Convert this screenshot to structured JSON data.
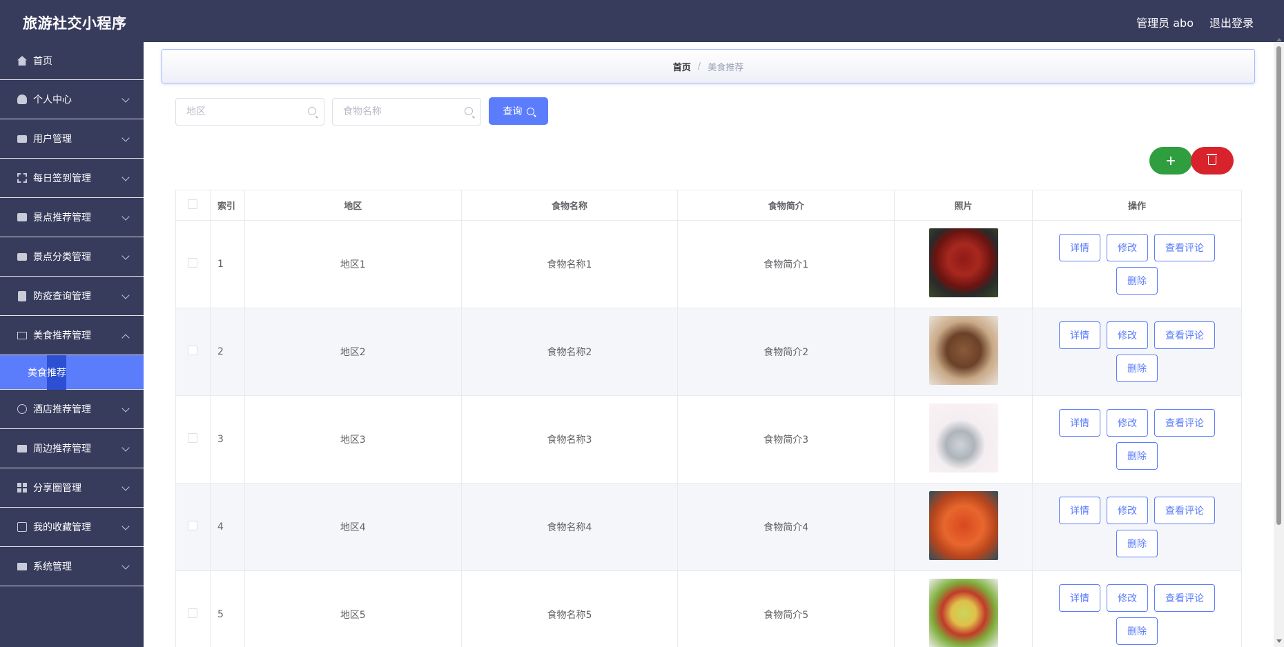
{
  "app": {
    "title": "旅游社交小程序"
  },
  "header": {
    "admin_label": "管理员 abo",
    "logout_label": "退出登录"
  },
  "sidebar": {
    "items": [
      {
        "label": "首页",
        "icon": "home-icon"
      },
      {
        "label": "个人中心",
        "icon": "user-icon"
      },
      {
        "label": "用户管理",
        "icon": "chat-icon"
      },
      {
        "label": "每日签到管理",
        "icon": "frame-icon"
      },
      {
        "label": "景点推荐管理",
        "icon": "briefcase-icon"
      },
      {
        "label": "景点分类管理",
        "icon": "board-icon"
      },
      {
        "label": "防疫查询管理",
        "icon": "clipboard-icon"
      },
      {
        "label": "美食推荐管理",
        "icon": "mail-icon"
      },
      {
        "label": "酒店推荐管理",
        "icon": "compass-icon"
      },
      {
        "label": "周边推荐管理",
        "icon": "monitor-icon"
      },
      {
        "label": "分享圈管理",
        "icon": "grid-icon"
      },
      {
        "label": "我的收藏管理",
        "icon": "copy-icon"
      },
      {
        "label": "系统管理",
        "icon": "monitor-icon"
      }
    ],
    "submenu": {
      "label": "美食推荐"
    }
  },
  "breadcrumb": {
    "home": "首页",
    "separator": "/",
    "current": "美食推荐"
  },
  "search": {
    "area_placeholder": "地区",
    "food_placeholder": "食物名称",
    "query_label": "查询"
  },
  "table": {
    "headers": {
      "index": "索引",
      "area": "地区",
      "name": "食物名称",
      "desc": "食物简介",
      "photo": "照片",
      "ops": "操作"
    },
    "ops": {
      "detail": "详情",
      "edit": "修改",
      "comments": "查看评论",
      "delete": "删除"
    },
    "rows": [
      {
        "index": "1",
        "area": "地区1",
        "name": "食物名称1",
        "desc": "食物简介1"
      },
      {
        "index": "2",
        "area": "地区2",
        "name": "食物名称2",
        "desc": "食物简介2"
      },
      {
        "index": "3",
        "area": "地区3",
        "name": "食物名称3",
        "desc": "食物简介3"
      },
      {
        "index": "4",
        "area": "地区4",
        "name": "食物名称4",
        "desc": "食物简介4"
      },
      {
        "index": "5",
        "area": "地区5",
        "name": "食物名称5",
        "desc": "食物简介5"
      }
    ]
  },
  "colors": {
    "primary": "#5b7cfb",
    "header_bg": "#373b5c",
    "add": "#2e9e3f",
    "delete": "#d9232c"
  }
}
